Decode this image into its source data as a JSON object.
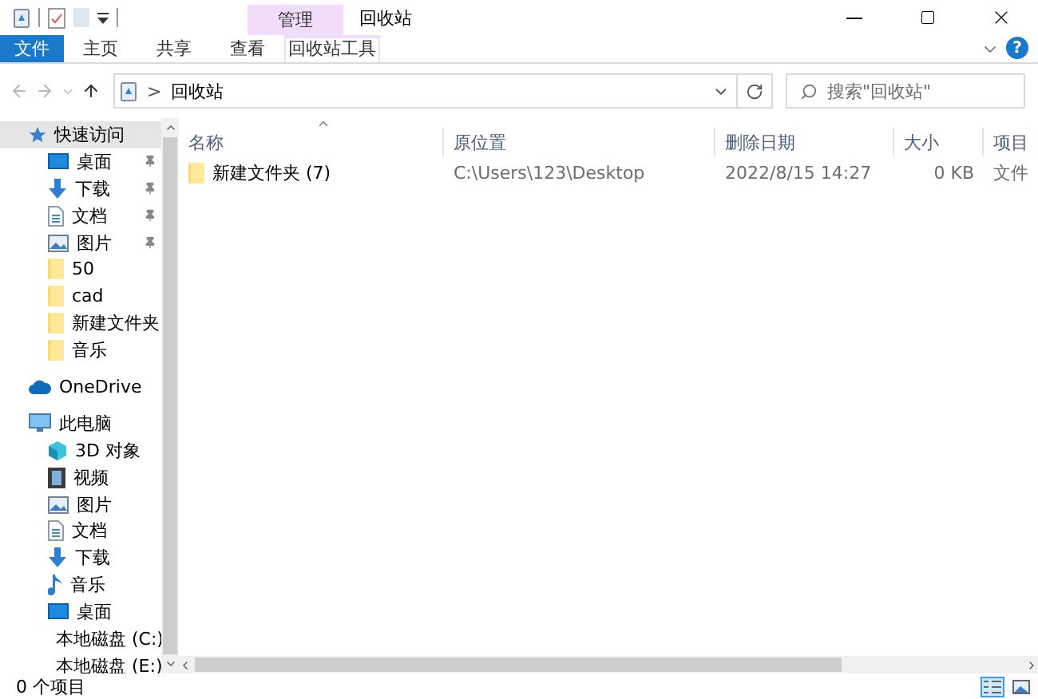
{
  "window": {
    "title": "回收站",
    "context_tab": "管理"
  },
  "ribbon": {
    "help": "?",
    "tabs": [
      {
        "label": "文件",
        "kind": "file",
        "selected": false
      },
      {
        "label": "主页",
        "kind": "tab",
        "selected": false
      },
      {
        "label": "共享",
        "kind": "tab",
        "selected": false
      },
      {
        "label": "查看",
        "kind": "tab",
        "selected": false
      },
      {
        "label": "回收站工具",
        "kind": "context",
        "selected": false
      }
    ]
  },
  "address": {
    "path": "回收站",
    "separator": ">"
  },
  "search": {
    "placeholder": "搜索\"回收站\""
  },
  "sidebar": {
    "items": [
      {
        "label": "快速访问",
        "kind": "star",
        "selected": true,
        "children": [
          {
            "label": "桌面",
            "kind": "desktop",
            "pinned": true
          },
          {
            "label": "下载",
            "kind": "download",
            "pinned": true
          },
          {
            "label": "文档",
            "kind": "document",
            "pinned": true
          },
          {
            "label": "图片",
            "kind": "picture",
            "pinned": true
          },
          {
            "label": "50",
            "kind": "folder",
            "pinned": false
          },
          {
            "label": "cad",
            "kind": "folder",
            "pinned": false
          },
          {
            "label": "新建文件夹",
            "kind": "folder",
            "pinned": false
          },
          {
            "label": "音乐",
            "kind": "folder",
            "pinned": false
          }
        ]
      },
      {
        "label": "OneDrive",
        "kind": "cloud",
        "selected": false
      },
      {
        "label": "此电脑",
        "kind": "pc",
        "selected": false,
        "children": [
          {
            "label": "3D 对象",
            "kind": "cube",
            "pinned": false
          },
          {
            "label": "视频",
            "kind": "video",
            "pinned": false
          },
          {
            "label": "图片",
            "kind": "picture",
            "pinned": false
          },
          {
            "label": "文档",
            "kind": "document",
            "pinned": false
          },
          {
            "label": "下载",
            "kind": "download",
            "pinned": false
          },
          {
            "label": "音乐",
            "kind": "music",
            "pinned": false
          },
          {
            "label": "桌面",
            "kind": "desktop",
            "pinned": false
          },
          {
            "label": "本地磁盘 (C:)",
            "kind": "drive",
            "pinned": false
          },
          {
            "label": "本地磁盘 (E:)",
            "kind": "drive",
            "pinned": false
          }
        ]
      }
    ]
  },
  "table": {
    "columns": [
      "名称",
      "原位置",
      "删除日期",
      "大小",
      "项目"
    ],
    "rows": [
      {
        "cells": [
          "新建文件夹 (7)",
          "C:\\Users\\123\\Desktop",
          "2022/8/15 14:27",
          "0 KB",
          "文件"
        ]
      }
    ]
  },
  "status_bar": {
    "text": "0 个项目",
    "views": [
      {
        "kind": "details",
        "selected": true
      },
      {
        "kind": "icons",
        "selected": false
      }
    ]
  }
}
